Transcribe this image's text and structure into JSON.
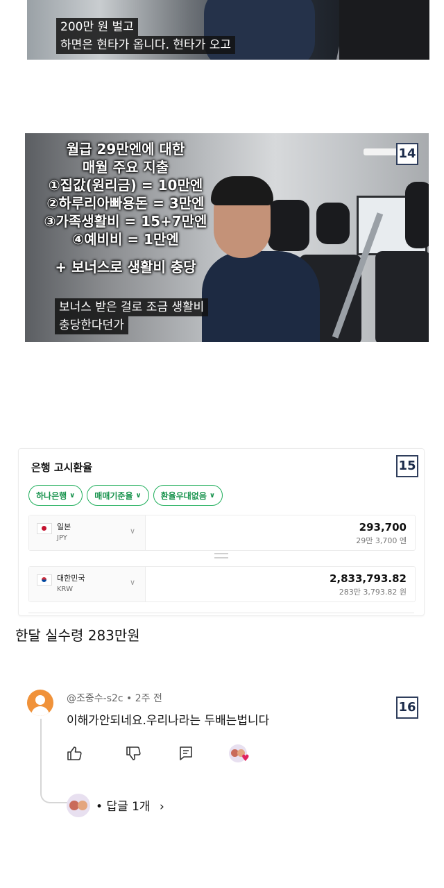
{
  "frame1": {
    "subtitle_line1": "200만 원 벌고",
    "subtitle_line2": "하면은 현타가 옵니다. 현타가 오고"
  },
  "frame2": {
    "overlay": {
      "title_line1": "월급 29만엔에 대한",
      "title_line2": "매월 주요 지출",
      "item1": "①집값(원리금) = 10만엔",
      "item2": "②하루리아빠용돈 = 3만엔",
      "item3": "③가족생활비 = 15+7만엔",
      "item4": "④예비비 = 1만엔",
      "bonus": "+ 보너스로 생활비 충당"
    },
    "subtitle_line1": "보너스 받은 걸로 조금 생활비",
    "subtitle_line2": "충당한다던가",
    "badge": "14"
  },
  "fx_card": {
    "title": "은행 고시환율",
    "badge": "15",
    "chips": [
      "하나은행",
      "매매기준율",
      "환율우대없음"
    ],
    "from": {
      "country": "일본",
      "code": "JPY",
      "flag_icon": "japan-flag-icon",
      "amount": "293,700",
      "amount_korean": "29만 3,700 엔"
    },
    "to": {
      "country": "대한민국",
      "code": "KRW",
      "flag_icon": "korea-flag-icon",
      "amount": "2,833,793.82",
      "amount_korean": "283만 3,793.82 원"
    }
  },
  "caption": "한달 실수령 283만원",
  "comment": {
    "author": "@조중수-s2c",
    "time": "2주 전",
    "separator": "•",
    "text": "이해가안되네요.우리나라는 두배는법니다",
    "badge": "16",
    "actions": [
      "like-icon",
      "dislike-icon",
      "reply-icon",
      "creator-heart-icon"
    ],
    "replies_label": "• 답글 1개",
    "replies_chevron": "›"
  },
  "colors": {
    "chip_green": "#1fae5b",
    "badge_navy": "#2f3e5c",
    "avatar_orange": "#f0923a",
    "heart_red": "#e0245e"
  }
}
